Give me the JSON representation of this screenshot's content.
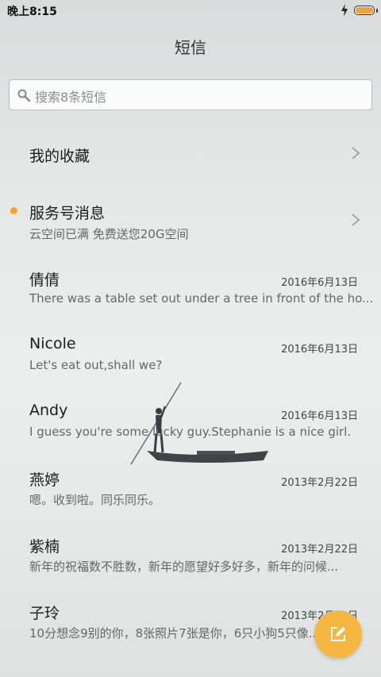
{
  "status_bar": {
    "time": "晚上8:15",
    "battery_color": "#f2a13a"
  },
  "header": {
    "title": "短信"
  },
  "search": {
    "placeholder": "搜索8条短信"
  },
  "favorites": {
    "label": "我的收藏"
  },
  "service": {
    "label": "服务号消息",
    "preview": "云空间已满 免费送您20G空间",
    "unread_color": "#f5a623"
  },
  "conversations": [
    {
      "name": "倩倩",
      "date": "2016年6月13日",
      "preview": "There was a table set out under a tree in front of the ho..."
    },
    {
      "name": "Nicole",
      "date": "2016年6月13日",
      "preview": "Let's eat out,shall we?"
    },
    {
      "name": "Andy",
      "date": "2016年6月13日",
      "preview": "I guess you're some lucky guy.Stephanie is a nice girl."
    },
    {
      "name": "燕婷",
      "date": "2013年2月22日",
      "preview": "嗯。收到啦。同乐同乐。"
    },
    {
      "name": "紫楠",
      "date": "2013年2月22日",
      "preview": "新年的祝福数不胜数，新年的愿望好多好多，新年的问候..."
    },
    {
      "name": "子玲",
      "date": "2013年2月22日",
      "preview": "10分想念9别的你，8张照片7张是你，6只小狗5只像..."
    }
  ],
  "fab": {
    "icon": "compose-icon",
    "color": "#f6b642"
  }
}
